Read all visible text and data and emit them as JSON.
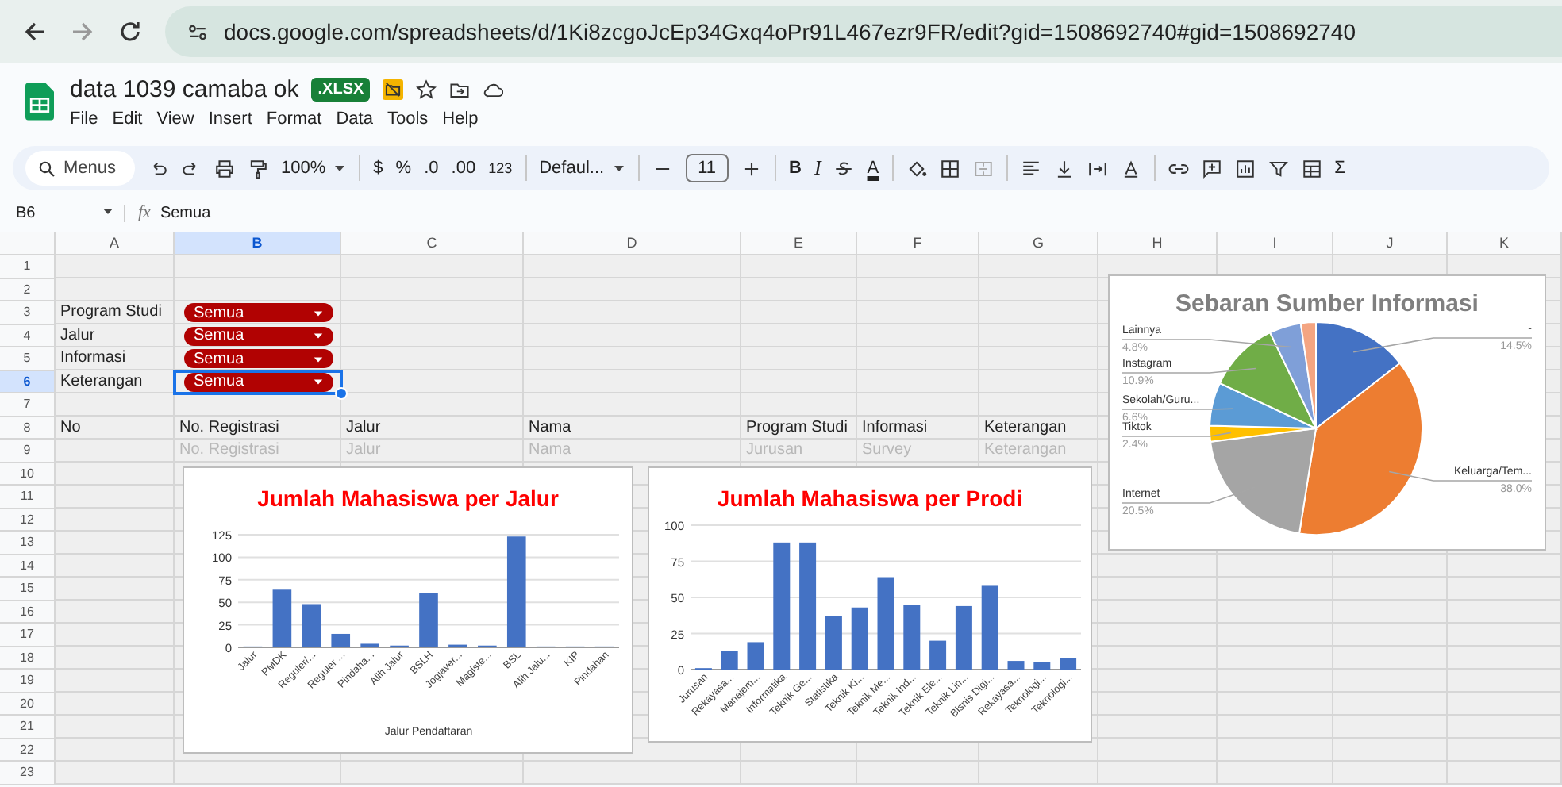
{
  "browser": {
    "url": "docs.google.com/spreadsheets/d/1Ki8zcgoJcEp34Gxq4oPr91L467ezr9FR/edit?gid=1508692740#gid=1508692740"
  },
  "document": {
    "title": "data 1039 camaba ok",
    "badge": ".XLSX",
    "menu": [
      "File",
      "Edit",
      "View",
      "Insert",
      "Format",
      "Data",
      "Tools",
      "Help"
    ]
  },
  "toolbar": {
    "search": "Menus",
    "zoom": "100%",
    "currency": "$",
    "percent": "%",
    "decrease_decimals": ".0",
    "increase_decimals": ".00",
    "number_format": "123",
    "font": "Defaul...",
    "font_size": "11",
    "bold": "B",
    "italic": "I",
    "text_color": "A",
    "sum": "Σ"
  },
  "formula_bar": {
    "cell": "B6",
    "fx": "fx",
    "formula": "Semua"
  },
  "sheet": {
    "columns": [
      {
        "label": "A",
        "selected": false
      },
      {
        "label": "B",
        "selected": true
      },
      {
        "label": "C",
        "selected": false
      },
      {
        "label": "D",
        "selected": false
      },
      {
        "label": "E",
        "selected": false
      },
      {
        "label": "F",
        "selected": false
      },
      {
        "label": "G",
        "selected": false
      },
      {
        "label": "H",
        "selected": false
      },
      {
        "label": "I",
        "selected": false
      },
      {
        "label": "J",
        "selected": false
      },
      {
        "label": "K",
        "selected": false
      }
    ],
    "rows": [
      {
        "label": "1",
        "selected": false,
        "cells": []
      },
      {
        "label": "2",
        "selected": false,
        "cells": []
      },
      {
        "label": "3",
        "selected": false,
        "cells": [
          {
            "kind": "text",
            "text": "Program Studi"
          },
          {
            "kind": "dropdown",
            "text": "Semua"
          }
        ]
      },
      {
        "label": "4",
        "selected": false,
        "cells": [
          {
            "kind": "text",
            "text": "Jalur"
          },
          {
            "kind": "dropdown",
            "text": "Semua"
          }
        ]
      },
      {
        "label": "5",
        "selected": false,
        "cells": [
          {
            "kind": "text",
            "text": "Informasi"
          },
          {
            "kind": "dropdown",
            "text": "Semua"
          }
        ]
      },
      {
        "label": "6",
        "selected": true,
        "cells": [
          {
            "kind": "text",
            "text": "Keterangan"
          },
          {
            "kind": "dropdown",
            "text": "Semua"
          }
        ]
      },
      {
        "label": "7",
        "selected": false,
        "cells": []
      },
      {
        "label": "8",
        "selected": false,
        "cells": [
          {
            "kind": "text",
            "text": "No"
          },
          {
            "kind": "text",
            "text": "No. Registrasi"
          },
          {
            "kind": "text",
            "text": "Jalur"
          },
          {
            "kind": "text",
            "text": "Nama"
          },
          {
            "kind": "text",
            "text": "Program Studi"
          },
          {
            "kind": "text",
            "text": "Informasi"
          },
          {
            "kind": "text",
            "text": "Keterangan"
          }
        ]
      },
      {
        "label": "9",
        "selected": false,
        "cells": [
          {
            "kind": "empty",
            "text": ""
          },
          {
            "kind": "faint",
            "text": "No. Registrasi"
          },
          {
            "kind": "faint",
            "text": "Jalur"
          },
          {
            "kind": "faint",
            "text": "Nama"
          },
          {
            "kind": "faint",
            "text": "Jurusan"
          },
          {
            "kind": "faint",
            "text": "Survey"
          },
          {
            "kind": "faint",
            "text": "Keterangan"
          }
        ]
      },
      {
        "label": "10",
        "selected": false,
        "cells": []
      },
      {
        "label": "11",
        "selected": false,
        "cells": []
      },
      {
        "label": "12",
        "selected": false,
        "cells": []
      },
      {
        "label": "13",
        "selected": false,
        "cells": []
      },
      {
        "label": "14",
        "selected": false,
        "cells": []
      },
      {
        "label": "15",
        "selected": false,
        "cells": []
      },
      {
        "label": "16",
        "selected": false,
        "cells": []
      },
      {
        "label": "17",
        "selected": false,
        "cells": []
      },
      {
        "label": "18",
        "selected": false,
        "cells": []
      },
      {
        "label": "19",
        "selected": false,
        "cells": []
      },
      {
        "label": "20",
        "selected": false,
        "cells": []
      },
      {
        "label": "21",
        "selected": false,
        "cells": []
      },
      {
        "label": "22",
        "selected": false,
        "cells": []
      },
      {
        "label": "23",
        "selected": false,
        "cells": []
      }
    ]
  },
  "charts": [
    {
      "chart_data": {
        "type": "bar",
        "title": "Jumlah Mahasiswa per Jalur",
        "xlabel": "Jalur Pendaftaran",
        "categories": [
          "Jalur",
          "PMDK",
          "Reguler/...",
          "Reguler ...",
          "Pindaha...",
          "Alih Jalur",
          "BSLH",
          "Jogjaver...",
          "Magiste...",
          "BSL",
          "Alih Jalu...",
          "KIP",
          "Pindahan"
        ],
        "series": [
          {
            "color": "#4472c4",
            "values": [
              1,
              64,
              48,
              15,
              4,
              2,
              60,
              3,
              2,
              123,
              1,
              1,
              1
            ]
          }
        ],
        "ylim": [
          0,
          125
        ],
        "yticks": [
          0,
          25,
          50,
          75,
          100,
          125
        ],
        "grid": true
      }
    },
    {
      "chart_data": {
        "type": "bar",
        "title": "Jumlah Mahasiswa per Prodi",
        "categories": [
          "Jurusan",
          "Rekayasa...",
          "Manajem...",
          "Informatika",
          "Teknik Ge...",
          "Statistika",
          "Teknik Ki...",
          "Teknik Me...",
          "Teknik Ind...",
          "Teknik Ele...",
          "Teknik Lin...",
          "Bisnis Digi...",
          "Rekayasa...",
          "Teknologi...",
          "Teknologi..."
        ],
        "series": [
          {
            "color": "#4472c4",
            "values": [
              1,
              13,
              19,
              88,
              88,
              37,
              43,
              64,
              45,
              20,
              44,
              58,
              6,
              5,
              8
            ]
          }
        ],
        "ylim": [
          0,
          100
        ],
        "yticks": [
          0,
          25,
          50,
          75,
          100
        ],
        "grid": true
      }
    },
    {
      "chart_data": {
        "type": "pie",
        "title": "Sebaran Sumber Informasi",
        "categories": [
          "-",
          "Keluarga/Tem...",
          "Internet",
          "Tiktok",
          "Sekolah/Guru...",
          "Instagram",
          "Lainnya",
          null
        ],
        "series": [
          {
            "values": [
              14.5,
              38.0,
              20.5,
              2.4,
              6.6,
              10.9,
              4.8,
              2.3
            ]
          }
        ],
        "colors": [
          "#4472c4",
          "#ed7d31",
          "#a5a5a5",
          "#ffc000",
          "#5b9bd5",
          "#70ad47",
          "#7f9fd8",
          "#f4a582"
        ],
        "value_labels": [
          "14.5%",
          "38.0%",
          "20.5%",
          "2.4%",
          "6.6%",
          "10.9%",
          "4.8%",
          null
        ]
      }
    }
  ]
}
